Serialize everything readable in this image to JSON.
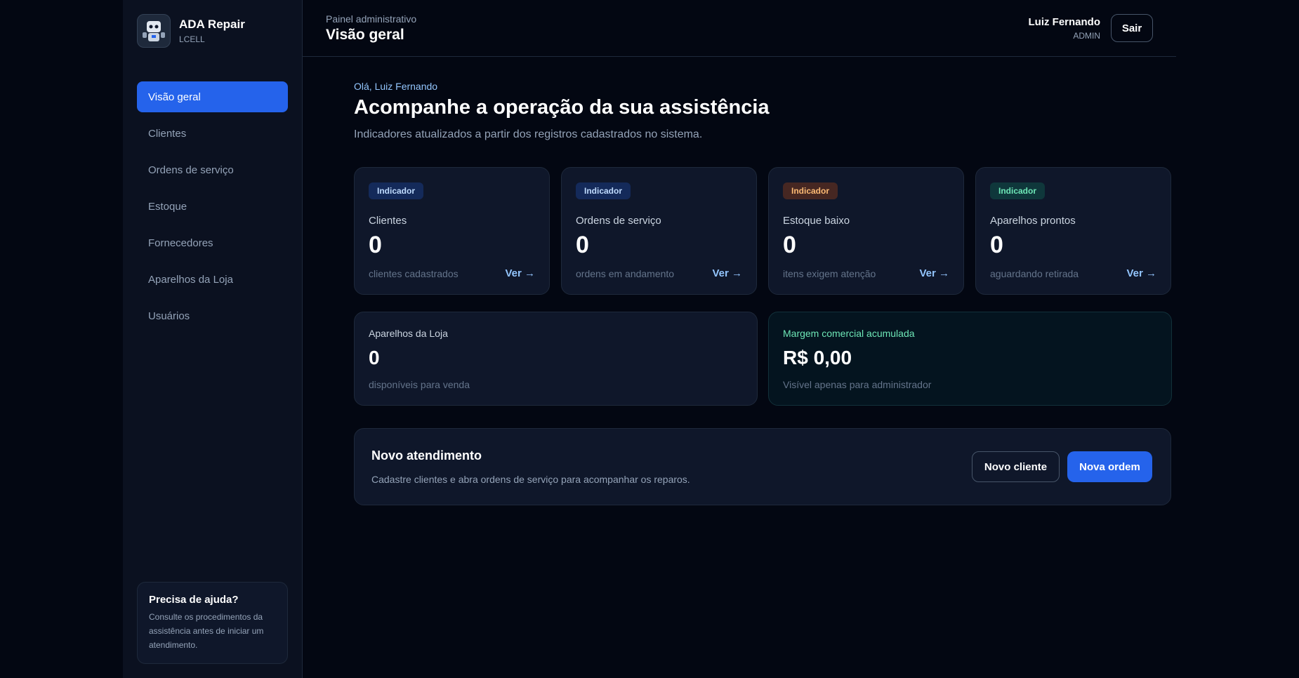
{
  "brand": {
    "name": "ADA Repair",
    "subtitle": "LCELL"
  },
  "sidebar": {
    "items": [
      {
        "label": "Visão geral",
        "active": true
      },
      {
        "label": "Clientes"
      },
      {
        "label": "Ordens de serviço"
      },
      {
        "label": "Estoque"
      },
      {
        "label": "Fornecedores"
      },
      {
        "label": "Aparelhos da Loja"
      },
      {
        "label": "Usuários"
      }
    ],
    "help": {
      "title": "Precisa de ajuda?",
      "text": "Consulte os procedimentos da assistência antes de iniciar um atendimento."
    }
  },
  "header": {
    "breadcrumb": "Painel administrativo",
    "title": "Visão geral",
    "user_name": "Luiz Fernando",
    "user_role": "ADMIN",
    "logout_label": "Sair"
  },
  "intro": {
    "greeting": "Olá, Luiz Fernando",
    "headline": "Acompanhe a operação da sua assistência",
    "subtitle": "Indicadores atualizados a partir dos registros cadastrados no sistema."
  },
  "stats": [
    {
      "badge": "Indicador",
      "badge_color": "#93c5fd",
      "label": "Clientes",
      "value": "0",
      "description": "clientes cadastrados",
      "link": "Ver →"
    },
    {
      "badge": "Indicador",
      "badge_color": "#93c5fd",
      "label": "Ordens de serviço",
      "value": "0",
      "description": "ordens em andamento",
      "link": "Ver →"
    },
    {
      "badge": "Indicador",
      "badge_color": "#fdba74",
      "label": "Estoque baixo",
      "value": "0",
      "description": "itens exigem atenção",
      "link": "Ver →"
    },
    {
      "badge": "Indicador",
      "badge_color": "#6ee7b7",
      "label": "Aparelhos prontos",
      "value": "0",
      "description": "aguardando retirada",
      "link": "Ver →"
    }
  ],
  "store_devices": {
    "label": "Aparelhos da Loja",
    "value": "0",
    "description": "disponíveis para venda"
  },
  "margin": {
    "label": "Margem comercial acumulada",
    "value": "R$ 0,00",
    "description": "Visível apenas para administrador"
  },
  "new_service": {
    "title": "Novo atendimento",
    "description": "Cadastre clientes e abra ordens de serviço para acompanhar os reparos.",
    "new_client_label": "Novo cliente",
    "new_order_label": "Nova ordem"
  },
  "colors": {
    "accent": "#2563eb",
    "background": "#030712",
    "card": "#0f172a"
  }
}
